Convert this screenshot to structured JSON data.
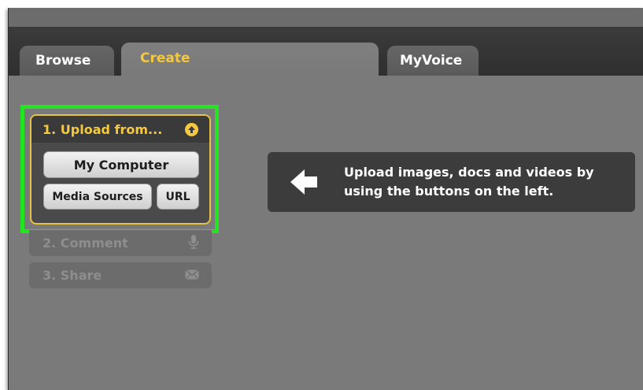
{
  "tabs": [
    {
      "label": "Browse"
    },
    {
      "label": "Create"
    },
    {
      "label": "MyVoice"
    }
  ],
  "steps": {
    "upload": {
      "title": "1. Upload from...",
      "icon": "up-arrow-icon",
      "buttons": {
        "my_computer": "My Computer",
        "media_sources": "Media Sources",
        "url": "URL"
      }
    },
    "comment": {
      "title": "2. Comment",
      "icon": "microphone-icon"
    },
    "share": {
      "title": "3. Share",
      "icon": "envelope-icon"
    }
  },
  "hint": {
    "icon": "left-arrow-icon",
    "text": "Upload images, docs and videos by using the buttons on the left."
  },
  "colors": {
    "accent_yellow": "#f5c842",
    "highlight_green": "#23e323",
    "panel_dark": "#3c3c3c",
    "background": "#7a7a7a"
  }
}
